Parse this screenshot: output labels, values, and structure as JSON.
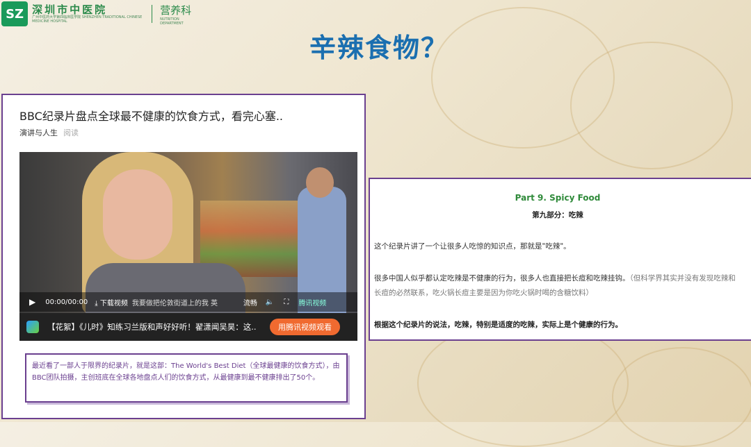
{
  "logo": {
    "mark_text": "SZ",
    "name_cn": "深圳市中医院",
    "name_sub": "广州中医药大学第四临床医学院 SHENZHEN TRADITIONAL CHINESE MEDICINE HOSPITAL",
    "dept_cn": "营养科",
    "dept_sub": "NUTRITION DEPARTMENT"
  },
  "slide_title": "辛辣食物？",
  "article": {
    "title": "BBC纪录片盘点全球最不健康的饮食方式，看完心塞..",
    "author": "演讲与人生",
    "reads": "阅读"
  },
  "video": {
    "play_icon": "play-icon",
    "time": "00:00/00:00",
    "download": "下载视频",
    "subtitle": "我要做把伦敦街道上的我 英",
    "quality": "流畅",
    "brand": "腾讯视频",
    "footer_text": "【花絮】《儿时》知练习兰版和声好好听！翟潇闻吴昊：这...",
    "footer_button": "用腾讯视频观看"
  },
  "note": {
    "text": "最近看了一部人于限界的纪录片，就是这部：The World's Best Diet（全球最健康的饮食方式），由BBC团队拍摄，主创班底在全球各地盘点人们的饮食方式，从最健康到最不健康排出了50个。"
  },
  "panel": {
    "heading_en": "Part 9. Spicy Food",
    "heading_cn": "第九部分：吃辣",
    "p1": "这个纪录片讲了一个让很多人吃惊的知识点，那就是\"吃辣\"。",
    "p2_main": "很多中国人似乎都认定吃辣是不健康的行为，很多人也直接把长痘和吃辣挂钩。",
    "p2_muted": "（但科学界其实并没有发现吃辣和长痘的必然联系，吃火锅长痘主要是因为你吃火锅时喝的含糖饮料）",
    "p3": "根据这个纪录片的说法，吃辣，特别是适度的吃辣，实际上是个健康的行为。"
  },
  "colors": {
    "title_blue": "#1b6fb0",
    "border_purple": "#6a3f8f",
    "logo_green": "#2a8a4a",
    "heading_green": "#2f8a3a"
  }
}
